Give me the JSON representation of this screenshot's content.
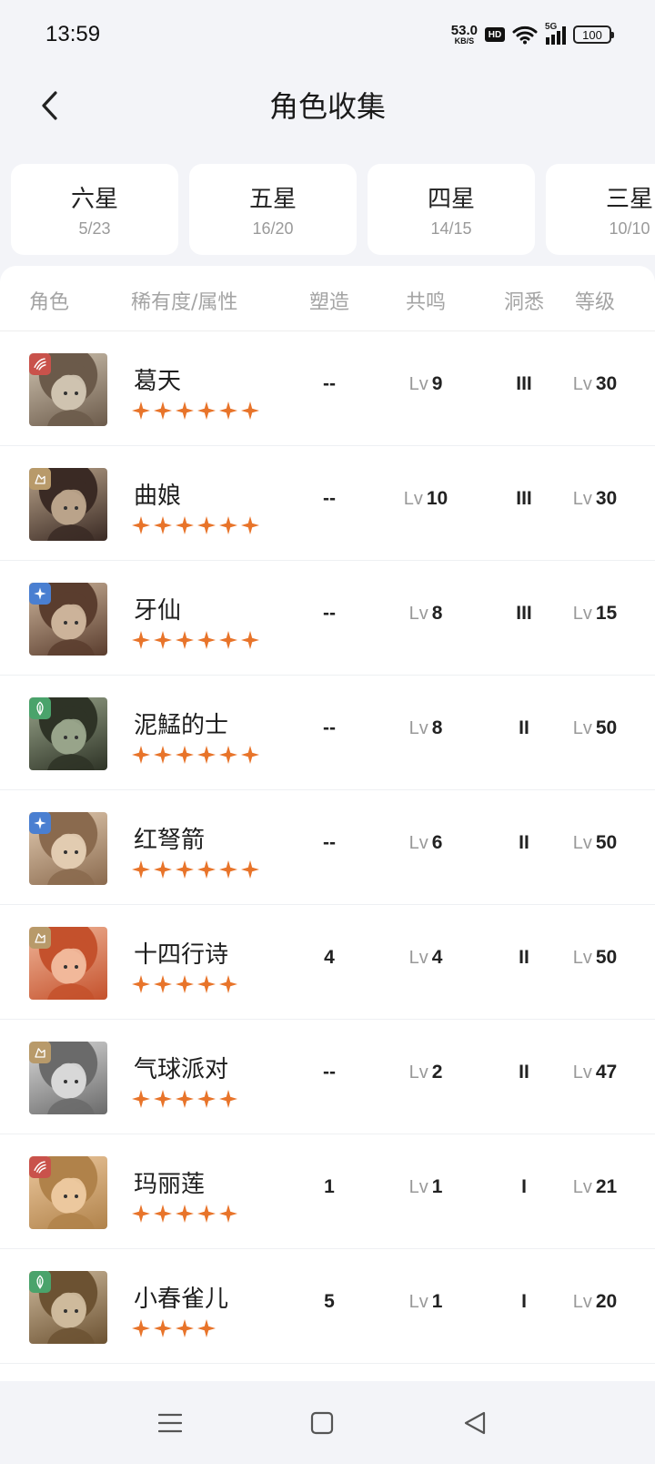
{
  "status_bar": {
    "time": "13:59",
    "speed_value": "53.0",
    "speed_unit": "KB/S",
    "hd": "HD",
    "network": "5G",
    "battery": "100"
  },
  "header": {
    "title": "角色收集"
  },
  "tabs": [
    {
      "label": "六星",
      "count": "5/23"
    },
    {
      "label": "五星",
      "count": "16/20"
    },
    {
      "label": "四星",
      "count": "14/15"
    },
    {
      "label": "三星",
      "count": "10/10"
    }
  ],
  "table": {
    "headers": {
      "role": "角色",
      "rarity": "稀有度/属性",
      "shaping": "塑造",
      "resonance": "共鸣",
      "insight": "洞悉",
      "level": "等级"
    },
    "lv_prefix": "Lv",
    "rows": [
      {
        "name": "葛天",
        "stars": 6,
        "attr_icon": "beast-attr-icon",
        "attr_color": "#c9524b",
        "shaping": "--",
        "resonance": "9",
        "insight": "III",
        "level": "30"
      },
      {
        "name": "曲娘",
        "stars": 6,
        "attr_icon": "mineral-attr-icon",
        "attr_color": "#b89a6a",
        "shaping": "--",
        "resonance": "10",
        "insight": "III",
        "level": "30"
      },
      {
        "name": "牙仙",
        "stars": 6,
        "attr_icon": "star-attr-icon",
        "attr_color": "#4a7fd1",
        "shaping": "--",
        "resonance": "8",
        "insight": "III",
        "level": "15"
      },
      {
        "name": "泥鯭的士",
        "stars": 6,
        "attr_icon": "plant-attr-icon",
        "attr_color": "#4aa36b",
        "shaping": "--",
        "resonance": "8",
        "insight": "II",
        "level": "50"
      },
      {
        "name": "红弩箭",
        "stars": 6,
        "attr_icon": "star-attr-icon",
        "attr_color": "#4a7fd1",
        "shaping": "--",
        "resonance": "6",
        "insight": "II",
        "level": "50"
      },
      {
        "name": "十四行诗",
        "stars": 5,
        "attr_icon": "mineral-attr-icon",
        "attr_color": "#b89a6a",
        "shaping": "4",
        "resonance": "4",
        "insight": "II",
        "level": "50"
      },
      {
        "name": "气球派对",
        "stars": 5,
        "attr_icon": "mineral-attr-icon",
        "attr_color": "#b89a6a",
        "shaping": "--",
        "resonance": "2",
        "insight": "II",
        "level": "47"
      },
      {
        "name": "玛丽莲",
        "stars": 5,
        "attr_icon": "beast-attr-icon",
        "attr_color": "#c9524b",
        "shaping": "1",
        "resonance": "1",
        "insight": "I",
        "level": "21"
      },
      {
        "name": "小春雀儿",
        "stars": 4,
        "attr_icon": "plant-attr-icon",
        "attr_color": "#4aa36b",
        "shaping": "5",
        "resonance": "1",
        "insight": "I",
        "level": "20"
      }
    ]
  },
  "colors": {
    "star": "#e8742a",
    "background": "#f3f4f8"
  }
}
